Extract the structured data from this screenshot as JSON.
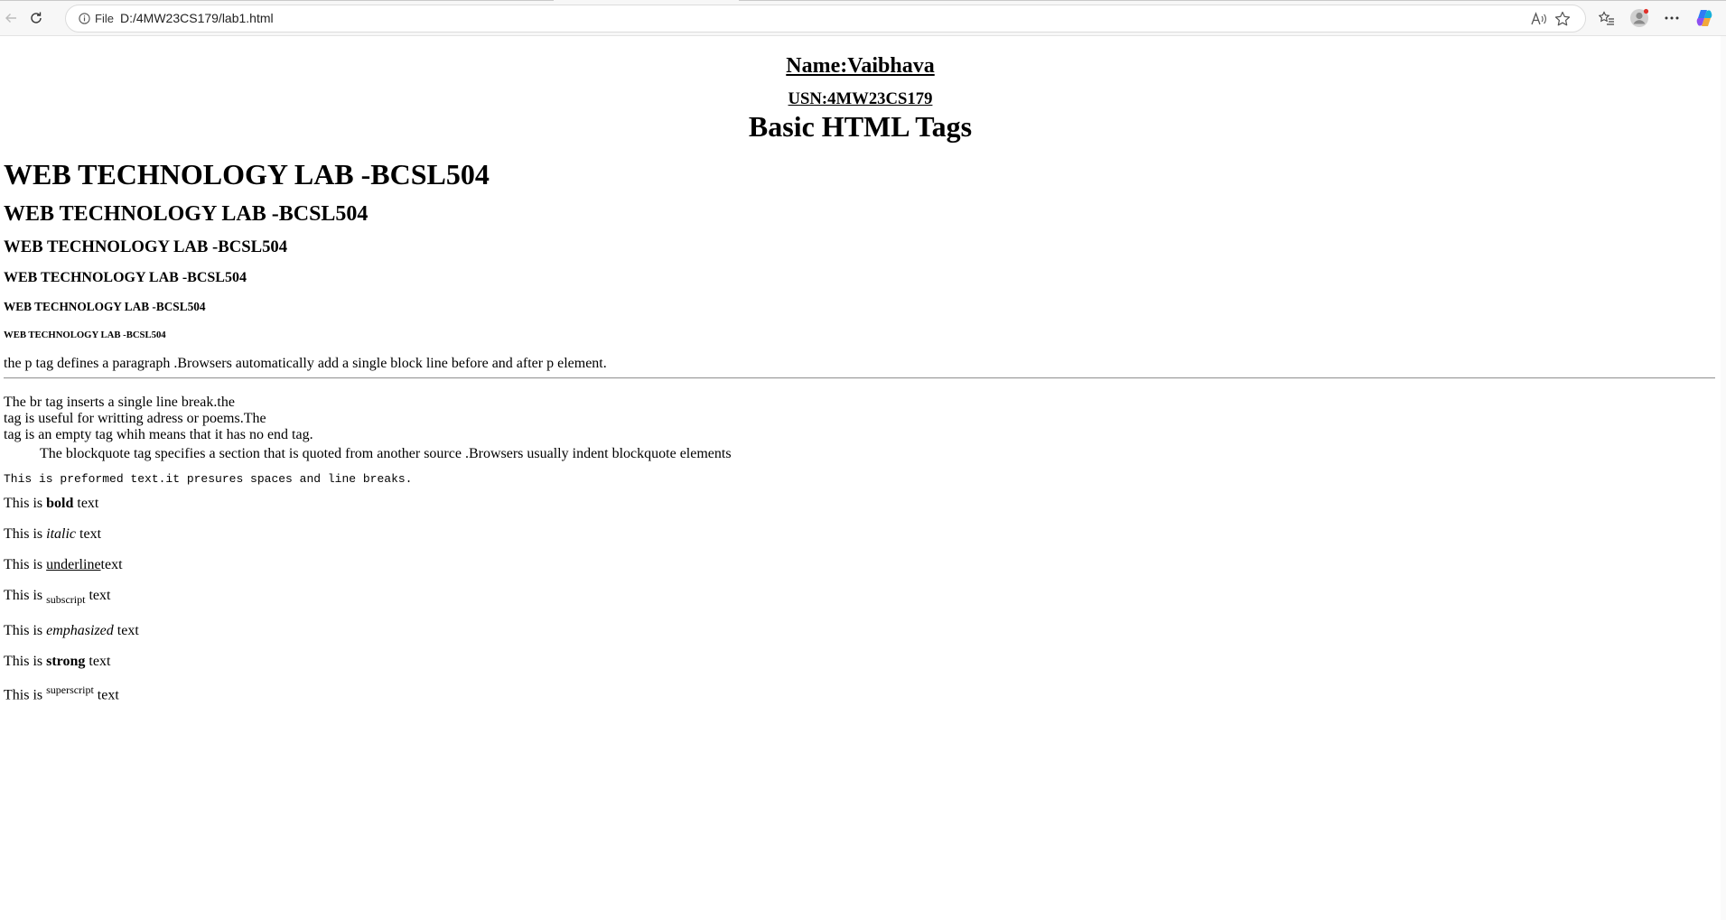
{
  "browser": {
    "site_info_label": "File",
    "url": "D:/4MW23CS179/lab1.html"
  },
  "page": {
    "name": "Name:Vaibhava",
    "usn": "USN:4MW23CS179",
    "title": "Basic HTML Tags",
    "headings": [
      "WEB TECHNOLOGY LAB -BCSL504",
      "WEB TECHNOLOGY LAB -BCSL504",
      "WEB TECHNOLOGY LAB -BCSL504",
      "WEB TECHNOLOGY LAB -BCSL504",
      "WEB TECHNOLOGY LAB -BCSL504",
      "WEB TECHNOLOGY LAB -BCSL504"
    ],
    "paragraph": "the p tag defines a paragraph .Browsers automatically add a single block line before and after p element.",
    "br_lines": [
      "The br tag inserts a single line break.the",
      "tag is useful for writting adress or poems.The",
      "tag is an empty tag whih means that it has no end tag."
    ],
    "blockquote": "The blockquote tag specifies a section that is quoted from another source .Browsers usually indent blockquote elements",
    "preformatted": "This is preformed text.it presures spaces and line breaks.",
    "formatting": {
      "prefix": "This is",
      "suffix": "text",
      "bold": "bold",
      "italic": "italic",
      "underline": "underline",
      "subscript": "subscript",
      "emphasized": "emphasized",
      "strong": "strong",
      "superscript": "superscript"
    }
  }
}
